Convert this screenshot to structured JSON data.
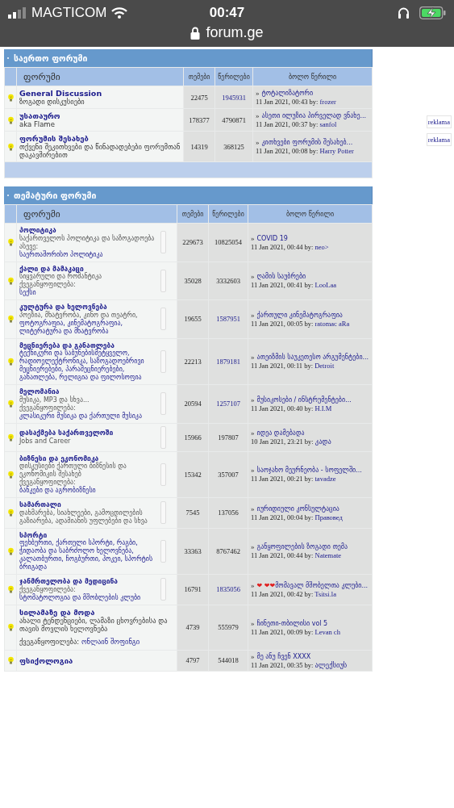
{
  "status_bar": {
    "carrier": "MAGTICOM",
    "time": "00:47"
  },
  "address_bar": {
    "url": "forum.ge"
  },
  "sections": [
    {
      "title": "საერთო ფორუმი",
      "columns": [
        "ფორუმი",
        "თემები",
        "წერილები",
        "ბოლო წერილი"
      ],
      "footer": true,
      "rows": [
        {
          "kind": "wide",
          "title": "General Discussion",
          "description": "ზოგადი დისკუსიები",
          "topics": "22475",
          "posts": {
            "value": "1945931",
            "link": true
          },
          "last_post": {
            "bullet": "»",
            "title": "ტოტალიზატორი",
            "date": "11 Jan 2021, 00:43 by:",
            "author": "frozer"
          }
        },
        {
          "kind": "wide",
          "title": "უსათაურო",
          "description": "aka Flame",
          "topics": "178377",
          "posts": {
            "value": "4790871",
            "link": false
          },
          "last_post": {
            "bullet": "»",
            "title": "ასეთი ილუზია პირველად ვნახე...",
            "date": "11 Jan 2021, 00:37 by:",
            "author": "sanfol"
          }
        },
        {
          "kind": "wide",
          "title": "ფორუმის შესახებ",
          "description": "თქვენი შეკითხვები და წინადადებები ფორუმთან დაკავშირებით",
          "topics": "14319",
          "posts": {
            "value": "368125",
            "link": false
          },
          "last_post": {
            "bullet": "»",
            "title": "კითხვები ფორუმის შესახებ...",
            "date": "11 Jan 2021, 00:08 by:",
            "author": "Harry Potter"
          }
        }
      ]
    },
    {
      "title": "თემატური ფორუმი",
      "columns": [
        "ფორუმი",
        "თემები",
        "წერილები",
        "ბოლო წერილი"
      ],
      "footer": false,
      "rows": [
        {
          "kind": "narrow",
          "title": "პოლიტიკა",
          "description": "საქართველოს პოლიტიკა და საზოგადოება",
          "subforum_label": "ასევე:",
          "subforums": "საერთაშორისო პოლიტიკა",
          "topics": "229673",
          "posts": {
            "value": "10825054",
            "link": false
          },
          "last_post": {
            "bullet": "»",
            "title": "COVID 19",
            "date": "11 Jan 2021, 00:44 by:",
            "author": "neo>"
          }
        },
        {
          "kind": "narrow",
          "title": "ქალი და მამაკაცი",
          "description": "სიყვარული და რომანტიკა",
          "subforum_label": "ქვეგანყოფილება:",
          "subforums": "სექსი",
          "topics": "35028",
          "posts": {
            "value": "3332603",
            "link": false
          },
          "last_post": {
            "bullet": "»",
            "title": "ღამის საუბრები",
            "date": "11 Jan 2021, 00:41 by:",
            "author": "LooLaa"
          }
        },
        {
          "kind": "narrow",
          "title": "კულტურა და ხელოვნება",
          "description": "პოეზია, მხატვრობა, კინო და თეატრი,",
          "subforums": "ფოტოგრაფია, კინემატოგრაფია, ლიტერატურა და მხატვრობა",
          "topics": "19655",
          "posts": {
            "value": "1587951",
            "link": true
          },
          "last_post": {
            "bullet": "»",
            "title": "ქართული კინემატოგრაფია",
            "date": "11 Jan 2021, 00:05 by:",
            "author": "ratomac aRa"
          }
        },
        {
          "kind": "narrow",
          "title": "მეცნიერება და განათლება",
          "subforums": "ტექნიკური და საბუნებისმეტყველო, რადიოელექტრონიკა, საზოგადოებრივი მეცნიერებები, პარამეცნიერებები, განათლება, რელიგია და ფილოსოფია",
          "topics": "22213",
          "posts": {
            "value": "1879181",
            "link": true
          },
          "last_post": {
            "bullet": "»",
            "title": "ათეიზმის საუკეთესო არგუმენტები...",
            "date": "11 Jan 2021, 00:11 by:",
            "author": "Detroit"
          }
        },
        {
          "kind": "narrow",
          "title": "მელომანია",
          "description": "მუსიკა, MP3 და სხვა...",
          "subforum_label": "ქვეგანყოფილება:",
          "subforums": "კლასიკური მუსიკა და ქართული მუსიკა",
          "topics": "20594",
          "posts": {
            "value": "1257107",
            "link": true
          },
          "last_post": {
            "bullet": "»",
            "title": "მუსიკოსები / ინსტრუმენტები...",
            "date": "11 Jan 2021, 00:40 by:",
            "author": "H.I.M"
          }
        },
        {
          "kind": "narrow",
          "title": "დასაქმება საქართველოში",
          "description": "Jobs and Career",
          "topics": "15966",
          "posts": {
            "value": "197807",
            "link": false
          },
          "last_post": {
            "bullet": "»",
            "title": "იდეა დამებადა",
            "date": "10 Jan 2021, 23:21 by:",
            "author": "კადა"
          }
        },
        {
          "kind": "narrow",
          "title": "ბიზნესი და ეკონომიკა",
          "description": "დისკუსიები ქართული ბიზნესის და ეკონომიკის შესახებ",
          "subforum_label": "ქვეგანყოფილება:",
          "subforums": "ბანკები და აგრობიზნესი",
          "topics": "15342",
          "posts": {
            "value": "357007",
            "link": false
          },
          "last_post": {
            "bullet": "»",
            "title": "საოჯახო მეურნეობა - სოფელში...",
            "date": "11 Jan 2021, 00:21 by:",
            "author": "tavadze"
          }
        },
        {
          "kind": "narrow",
          "title": "სამართალი",
          "description": "დახმარება, სიახლეები, გამოცდილების გაზიარება, ადამიანის უფლებები და სხვა",
          "topics": "7545",
          "posts": {
            "value": "137056",
            "link": false
          },
          "last_post": {
            "bullet": "»",
            "title": "იურიდიული კონსულტაცია",
            "date": "11 Jan 2021, 00:04 by:",
            "author": "Правовед"
          }
        },
        {
          "kind": "narrow",
          "title": "სპორტი",
          "subforums": "ფეხბურთი, ქართული სპორტი, რაგბი, ჭიდაობა და საბრძოლო ხელოვნება, კალათბურთი, ჩოგბურთი, ჰოკეი, სპორტის ბრიგადა",
          "topics": "33363",
          "posts": {
            "value": "8767462",
            "link": false
          },
          "last_post": {
            "bullet": "»",
            "title": "განყოფილების ზოგადი თემა",
            "date": "11 Jan 2021, 00:44 by:",
            "author": "Natemate"
          }
        },
        {
          "kind": "narrow",
          "title": "ჯანმრთელობა და მედიცინა",
          "subforum_label": "ქვეგანყოფილება:",
          "subforums": "სტომატოლოგია და მშობლების კლუბი",
          "topics": "16791",
          "posts": {
            "value": "1835056",
            "link": true
          },
          "last_post": {
            "bullet": "»",
            "prefix": "❤ ❤❤",
            "title": "მომავალ მშობელთა კლუბი...",
            "date": "11 Jan 2021, 00:42 by:",
            "author": "Tsitsi.la"
          }
        },
        {
          "kind": "wide",
          "title": "სილამაზე და მოდა",
          "description": "ახალი ტენდენციები, ლამაზი ცხოვრებისა და თავის მოვლის ხელოვნება",
          "subforum_label": "ქვეგანყოფილება:",
          "subforums": "ონლაინ შოფინგი",
          "topics": "4739",
          "posts": {
            "value": "555979",
            "link": false
          },
          "last_post": {
            "bullet": "»",
            "title": "ჩინეთი-თბილისი vol 5",
            "date": "11 Jan 2021, 00:09 by:",
            "author": "Levan ch"
          }
        },
        {
          "kind": "wide",
          "title": "ფსიქოლოგია",
          "topics": "4797",
          "posts": {
            "value": "544018",
            "link": false
          },
          "last_post": {
            "bullet": "»",
            "title": "მე ანუ ჩვენ XXXX",
            "date": "11 Jan 2021, 00:35 by:",
            "author": "ალექსიუს"
          }
        }
      ]
    }
  ],
  "ads": [
    "reklama",
    "reklama"
  ]
}
